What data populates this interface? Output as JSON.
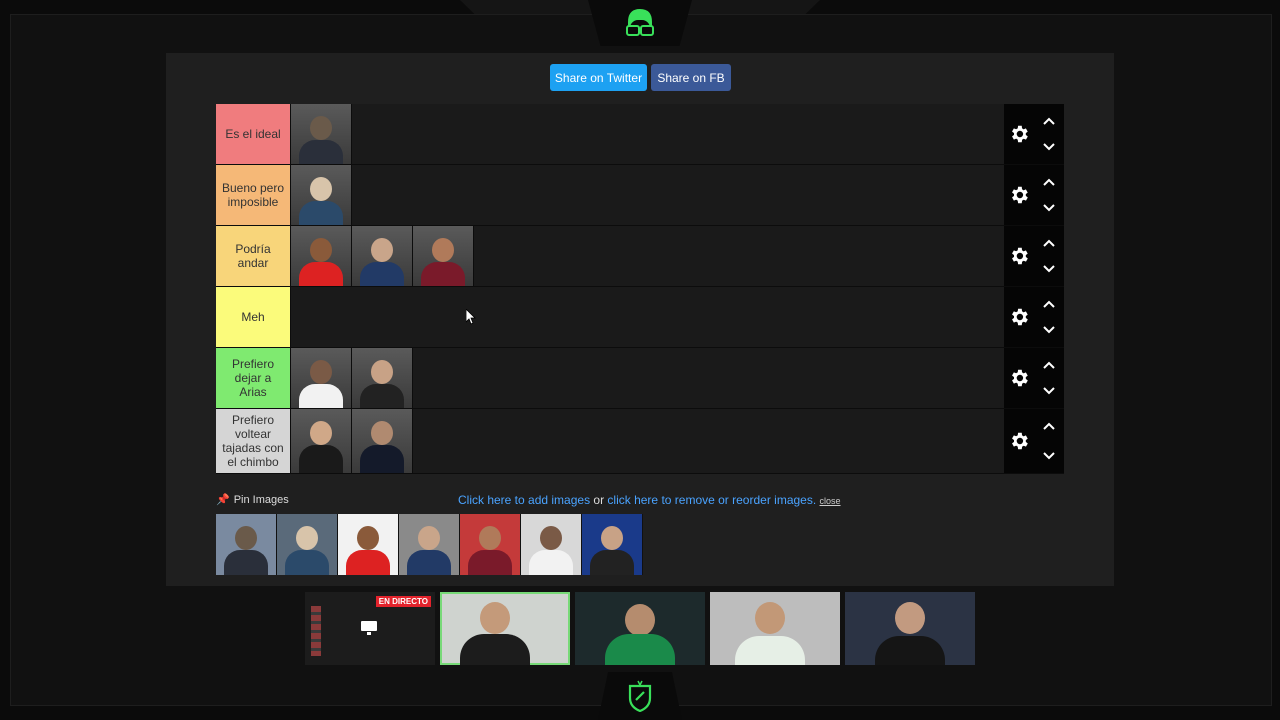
{
  "colors": {
    "accent": "#39e05a",
    "share_twitter": "#1da1f2",
    "share_fb": "#3b5998",
    "link": "#4aa3ff",
    "live_badge": "#e3232c"
  },
  "share": {
    "twitter_label": "Share on Twitter",
    "fb_label": "Share on FB"
  },
  "tiers": [
    {
      "label": "Es el ideal",
      "color": "#f07c7e",
      "images": 1
    },
    {
      "label": "Bueno pero imposible",
      "color": "#f5b877",
      "images": 1
    },
    {
      "label": "Podría andar",
      "color": "#f8d57a",
      "images": 3
    },
    {
      "label": "Meh",
      "color": "#fbfb7b",
      "images": 0
    },
    {
      "label": "Prefiero dejar a Arias",
      "color": "#7fea70",
      "images": 2
    },
    {
      "label": "Prefiero voltear tajadas con el chimbo",
      "color": "#d5d5d5",
      "images": 2
    }
  ],
  "footer": {
    "pin_label": "Pin Images",
    "add_link": "Click here to add images",
    "or_text": " or ",
    "remove_link": "click here to remove or reorder images.",
    "close_label": "close"
  },
  "pool_count": 7,
  "cams": {
    "live_badge": "EN DIRECTO"
  },
  "icons": [
    "avatar-logo",
    "gear-icon",
    "chevron-up-icon",
    "chevron-down-icon",
    "pin-icon",
    "shield-logo",
    "monitor-icon"
  ]
}
